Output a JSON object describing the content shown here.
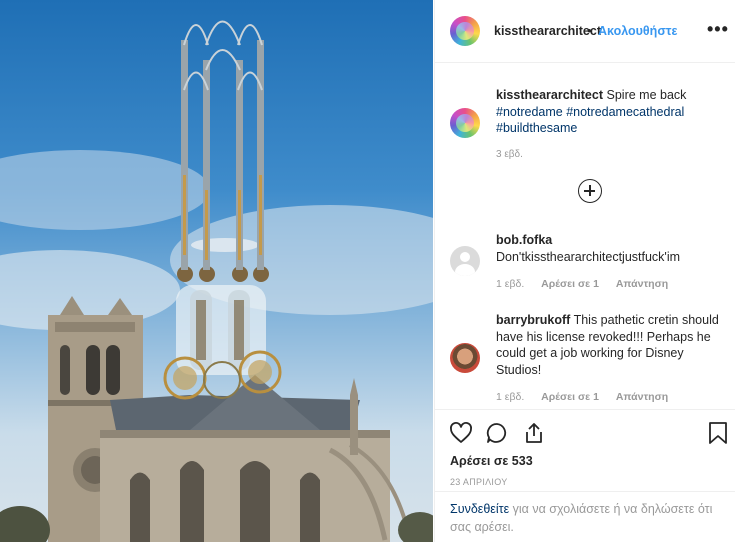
{
  "post_image": {
    "subject": "notre-dame-cathedral-with-futuristic-spire"
  },
  "header": {
    "username": "kisstheararchitect",
    "separator": "•",
    "follow_label": "Ακολουθήστε",
    "more_label": "•••"
  },
  "caption": {
    "username": "kisstheararchitect",
    "text": "Spire me back",
    "hashtags": [
      "#notredame",
      "#notredamecathedral",
      "#buildthesame"
    ],
    "time": "3 εβδ."
  },
  "comments": [
    {
      "username": "bob.fofka",
      "text": "Don'tkisstheararchitectjustfuck'im",
      "time": "1 εβδ.",
      "likes": "Αρέσει σε 1",
      "reply_label": "Απάντηση"
    },
    {
      "username": "barrybrukoff",
      "text": "This pathetic cretin should have his license revoked!!! Perhaps he could get a job working for Disney Studios!",
      "time": "1 εβδ.",
      "likes": "Αρέσει σε 1",
      "reply_label": "Απάντηση"
    }
  ],
  "icons": {
    "like": "heart-icon",
    "comment": "comment-icon",
    "share": "share-icon",
    "save": "bookmark-icon",
    "load_more": "plus-circle-icon",
    "more": "more-dots-icon"
  },
  "likes": "Αρέσει σε 533",
  "date": "23 ΑΠΡΙΛΙΟΥ",
  "footer": {
    "login_link": "Συνδεθείτε",
    "text": " για να σχολιάσετε ή να δηλώσετε ότι σας αρέσει."
  },
  "colors": {
    "accent": "#3897f0",
    "hashtag": "#003569",
    "muted": "#999999",
    "border": "#efefef"
  }
}
